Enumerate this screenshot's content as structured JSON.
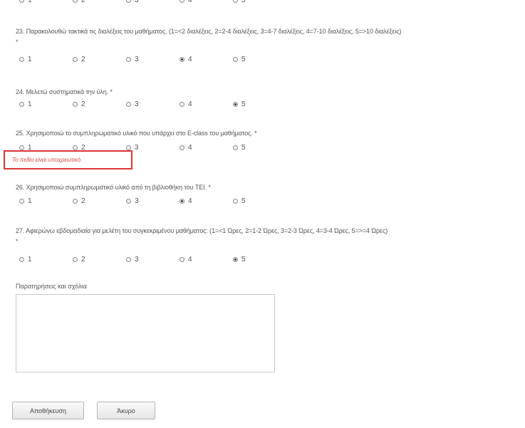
{
  "top_partial_row": {
    "labels": [
      "1",
      "2",
      "3",
      "4",
      "5"
    ]
  },
  "questions": [
    {
      "number_text": "23. Παρακολουθώ τακτικά τις διαλέξεις του μαθήματος. (1=<2 διαλέξεις, 2=2-4 διαλέξεις, 3=4-7 διαλέξεις, 4=7-10 διαλέξεις, 5=>10 διαλέξεις)",
      "required_marker": "*",
      "options": [
        "1",
        "2",
        "3",
        "4",
        "5"
      ],
      "selected": "4"
    },
    {
      "number_text": "24. Μελετώ συστηματικά την ύλη. *",
      "options": [
        "1",
        "2",
        "3",
        "4",
        "5"
      ],
      "selected": "5"
    },
    {
      "number_text": "25. Χρησιμοποιώ το συμπληρωματικό υλικό που υπάρχει στο E-class του μαθήματος. *",
      "options": [
        "1",
        "2",
        "3",
        "4",
        "5"
      ],
      "selected": null,
      "error": "Το πεδίο είναι υποχρεωτικό."
    },
    {
      "number_text": "26. Χρησιμοποιώ συμπληρωματικό υλικό από τη βιβλιοθήκη του TEI. *",
      "options": [
        "1",
        "2",
        "3",
        "4",
        "5"
      ],
      "selected": "4"
    },
    {
      "number_text": "27. Αφιερώνω εβδομαδιαία για μελέτη του συγκεκριμένου μαθήματος: (1=<1 Ώρες, 2=1-2 Ώρες, 3=2-3 Ώρες, 4=3-4 Ώρες, 5=>=4 Ώρες)",
      "required_marker": "*",
      "options": [
        "1",
        "2",
        "3",
        "4",
        "5"
      ],
      "selected": "5"
    }
  ],
  "comments": {
    "label": "Παρατηρήσεις και σχόλια",
    "value": ""
  },
  "buttons": {
    "save_label": "Αποθήκευση",
    "cancel_label": "Άκυρο"
  },
  "colors": {
    "error": "#d9343c",
    "text": "#555555",
    "border": "#c9c9c9"
  }
}
